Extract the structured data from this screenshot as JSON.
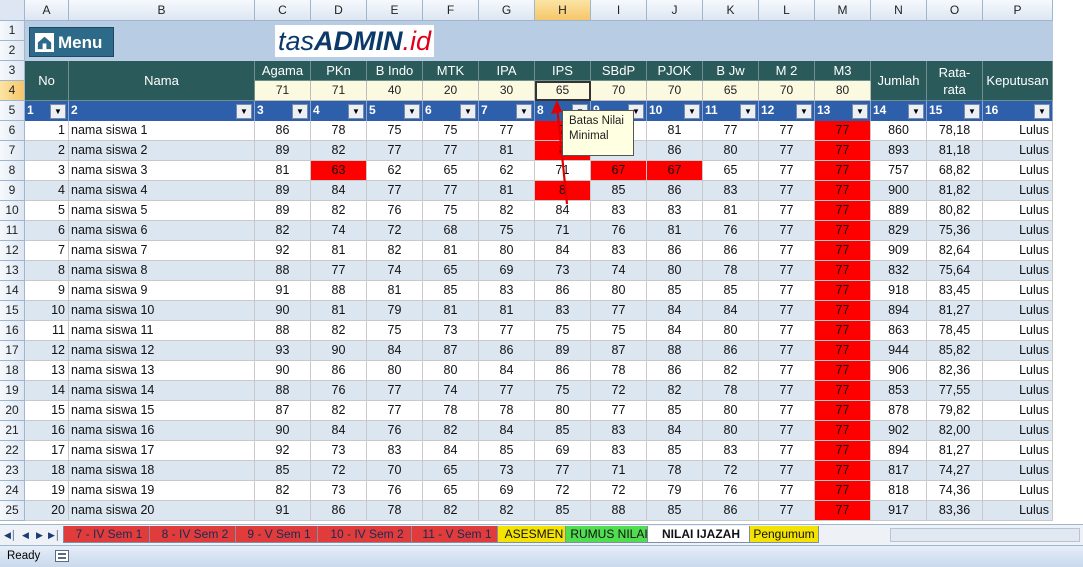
{
  "columns": [
    "A",
    "B",
    "C",
    "D",
    "E",
    "F",
    "G",
    "H",
    "I",
    "J",
    "K",
    "L",
    "M",
    "N",
    "O",
    "P"
  ],
  "selected_column": "H",
  "selected_row": "4",
  "menu_label": "Menu",
  "brand": {
    "part1": "tas",
    "part2": "ADMIN",
    "part3": ".id"
  },
  "headers": {
    "no": "No",
    "nama": "Nama",
    "subjects": [
      "Agama",
      "PKn",
      "B Indo",
      "MTK",
      "IPA",
      "IPS",
      "SBdP",
      "PJOK",
      "B Jw",
      "M 2",
      "M3"
    ],
    "jumlah": "Jumlah",
    "rata_line1": "Rata-",
    "rata_line2": "rata",
    "keputusan": "Keputusan"
  },
  "kkm": [
    "71",
    "71",
    "40",
    "20",
    "30",
    "65",
    "70",
    "70",
    "65",
    "70",
    "80"
  ],
  "filter_numbers": [
    "1",
    "2",
    "3",
    "4",
    "5",
    "6",
    "7",
    "8",
    "9",
    "10",
    "11",
    "12",
    "13",
    "14",
    "15",
    "16"
  ],
  "tooltip": {
    "line1": "Batas Nilai",
    "line2": "Minimal"
  },
  "rows": [
    {
      "row": "6",
      "no": "1",
      "nama": "nama siswa 1",
      "scores": [
        "86",
        "78",
        "75",
        "75",
        "77",
        "7",
        "",
        "81",
        "77",
        "77",
        "77"
      ],
      "jumlah": "860",
      "rata": "78,18",
      "ket": "Lulus"
    },
    {
      "row": "7",
      "no": "2",
      "nama": "nama siswa 2",
      "scores": [
        "89",
        "82",
        "77",
        "77",
        "81",
        "8",
        "",
        "86",
        "80",
        "77",
        "77"
      ],
      "jumlah": "893",
      "rata": "81,18",
      "ket": "Lulus"
    },
    {
      "row": "8",
      "no": "3",
      "nama": "nama siswa 3",
      "scores": [
        "81",
        "63",
        "62",
        "65",
        "62",
        "71",
        "67",
        "67",
        "65",
        "77",
        "77"
      ],
      "jumlah": "757",
      "rata": "68,82",
      "ket": "Lulus"
    },
    {
      "row": "9",
      "no": "4",
      "nama": "nama siswa 4",
      "scores": [
        "89",
        "84",
        "77",
        "77",
        "81",
        "8",
        "85",
        "86",
        "83",
        "77",
        "77"
      ],
      "jumlah": "900",
      "rata": "81,82",
      "ket": "Lulus"
    },
    {
      "row": "10",
      "no": "5",
      "nama": "nama siswa 5",
      "scores": [
        "89",
        "82",
        "76",
        "75",
        "82",
        "84",
        "83",
        "83",
        "81",
        "77",
        "77"
      ],
      "jumlah": "889",
      "rata": "80,82",
      "ket": "Lulus"
    },
    {
      "row": "11",
      "no": "6",
      "nama": "nama siswa 6",
      "scores": [
        "82",
        "74",
        "72",
        "68",
        "75",
        "71",
        "76",
        "81",
        "76",
        "77",
        "77"
      ],
      "jumlah": "829",
      "rata": "75,36",
      "ket": "Lulus"
    },
    {
      "row": "12",
      "no": "7",
      "nama": "nama siswa 7",
      "scores": [
        "92",
        "81",
        "82",
        "81",
        "80",
        "84",
        "83",
        "86",
        "86",
        "77",
        "77"
      ],
      "jumlah": "909",
      "rata": "82,64",
      "ket": "Lulus"
    },
    {
      "row": "13",
      "no": "8",
      "nama": "nama siswa 8",
      "scores": [
        "88",
        "77",
        "74",
        "65",
        "69",
        "73",
        "74",
        "80",
        "78",
        "77",
        "77"
      ],
      "jumlah": "832",
      "rata": "75,64",
      "ket": "Lulus"
    },
    {
      "row": "14",
      "no": "9",
      "nama": "nama siswa 9",
      "scores": [
        "91",
        "88",
        "81",
        "85",
        "83",
        "86",
        "80",
        "85",
        "85",
        "77",
        "77"
      ],
      "jumlah": "918",
      "rata": "83,45",
      "ket": "Lulus"
    },
    {
      "row": "15",
      "no": "10",
      "nama": "nama siswa 10",
      "scores": [
        "90",
        "81",
        "79",
        "81",
        "81",
        "83",
        "77",
        "84",
        "84",
        "77",
        "77"
      ],
      "jumlah": "894",
      "rata": "81,27",
      "ket": "Lulus"
    },
    {
      "row": "16",
      "no": "11",
      "nama": "nama siswa 11",
      "scores": [
        "88",
        "82",
        "75",
        "73",
        "77",
        "75",
        "75",
        "84",
        "80",
        "77",
        "77"
      ],
      "jumlah": "863",
      "rata": "78,45",
      "ket": "Lulus"
    },
    {
      "row": "17",
      "no": "12",
      "nama": "nama siswa 12",
      "scores": [
        "93",
        "90",
        "84",
        "87",
        "86",
        "89",
        "87",
        "88",
        "86",
        "77",
        "77"
      ],
      "jumlah": "944",
      "rata": "85,82",
      "ket": "Lulus"
    },
    {
      "row": "18",
      "no": "13",
      "nama": "nama siswa 13",
      "scores": [
        "90",
        "86",
        "80",
        "80",
        "84",
        "86",
        "78",
        "86",
        "82",
        "77",
        "77"
      ],
      "jumlah": "906",
      "rata": "82,36",
      "ket": "Lulus"
    },
    {
      "row": "19",
      "no": "14",
      "nama": "nama siswa 14",
      "scores": [
        "88",
        "76",
        "77",
        "74",
        "77",
        "75",
        "72",
        "82",
        "78",
        "77",
        "77"
      ],
      "jumlah": "853",
      "rata": "77,55",
      "ket": "Lulus"
    },
    {
      "row": "20",
      "no": "15",
      "nama": "nama siswa 15",
      "scores": [
        "87",
        "82",
        "77",
        "78",
        "78",
        "80",
        "77",
        "85",
        "80",
        "77",
        "77"
      ],
      "jumlah": "878",
      "rata": "79,82",
      "ket": "Lulus"
    },
    {
      "row": "21",
      "no": "16",
      "nama": "nama siswa 16",
      "scores": [
        "90",
        "84",
        "76",
        "82",
        "84",
        "85",
        "83",
        "84",
        "80",
        "77",
        "77"
      ],
      "jumlah": "902",
      "rata": "82,00",
      "ket": "Lulus"
    },
    {
      "row": "22",
      "no": "17",
      "nama": "nama siswa 17",
      "scores": [
        "92",
        "73",
        "83",
        "84",
        "85",
        "69",
        "83",
        "85",
        "83",
        "77",
        "77"
      ],
      "jumlah": "894",
      "rata": "81,27",
      "ket": "Lulus"
    },
    {
      "row": "23",
      "no": "18",
      "nama": "nama siswa 18",
      "scores": [
        "85",
        "72",
        "70",
        "65",
        "73",
        "77",
        "71",
        "78",
        "72",
        "77",
        "77"
      ],
      "jumlah": "817",
      "rata": "74,27",
      "ket": "Lulus"
    },
    {
      "row": "24",
      "no": "19",
      "nama": "nama siswa 19",
      "scores": [
        "82",
        "73",
        "76",
        "65",
        "69",
        "72",
        "72",
        "79",
        "76",
        "77",
        "77"
      ],
      "jumlah": "818",
      "rata": "74,36",
      "ket": "Lulus"
    },
    {
      "row": "25",
      "no": "20",
      "nama": "nama siswa 20",
      "scores": [
        "91",
        "86",
        "78",
        "82",
        "82",
        "85",
        "88",
        "85",
        "86",
        "77",
        "77"
      ],
      "jumlah": "917",
      "rata": "83,36",
      "ket": "Lulus"
    }
  ],
  "sheet_tabs": [
    {
      "label": "7 - IV Sem 1",
      "color": "red"
    },
    {
      "label": "8 - IV Sem 2",
      "color": "red"
    },
    {
      "label": "9 - V Sem 1",
      "color": "red"
    },
    {
      "label": "10 - IV Sem 2",
      "color": "red"
    },
    {
      "label": "11 - V Sem 1",
      "color": "red"
    },
    {
      "label": "ASESMEN",
      "color": "yellow"
    },
    {
      "label": "RUMUS NILAI",
      "color": "green"
    },
    {
      "label": "NILAI IJAZAH",
      "color": "active"
    },
    {
      "label": "Pengumum",
      "color": "yellow"
    }
  ],
  "status": "Ready",
  "colors": {
    "header_dark": "#2b5a5a",
    "filter_blue": "#2d5fab",
    "fail_red": "#ff0000",
    "kkm_bg": "#fbf9e0",
    "stripe": "#dce6f1"
  }
}
